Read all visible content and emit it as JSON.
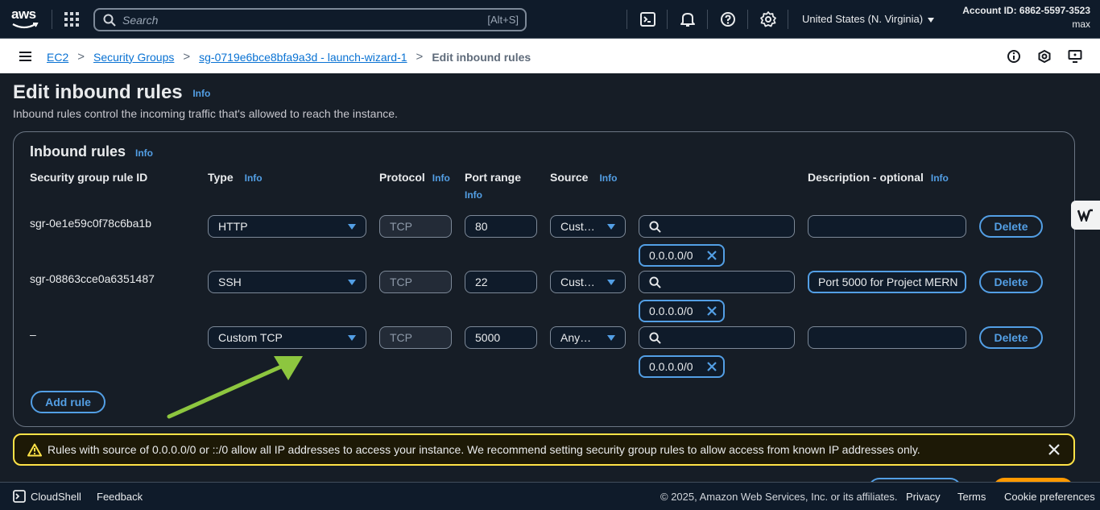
{
  "topnav": {
    "logo": "aws",
    "search_placeholder": "Search",
    "search_shortcut": "[Alt+S]",
    "region": "United States (N. Virginia)",
    "account_id": "Account ID: 6862-5597-3523",
    "user": "max",
    "icons": [
      "services-grid-icon",
      "cloudshell-icon",
      "bell-icon",
      "help-icon",
      "gear-icon"
    ]
  },
  "breadcrumb": {
    "items": [
      "EC2",
      "Security Groups",
      "sg-0719e6bce8bfa9a3d - launch-wizard-1"
    ],
    "current": "Edit inbound rules",
    "separator": ">"
  },
  "page": {
    "title": "Edit inbound rules",
    "info": "Info",
    "description": "Inbound rules control the incoming traffic that's allowed to reach the instance."
  },
  "container": {
    "title": "Inbound rules",
    "info": "Info",
    "columns": {
      "rule_id": "Security group rule ID",
      "type": "Type",
      "protocol": "Protocol",
      "port_range": "Port range",
      "source": "Source",
      "description": "Description - optional"
    },
    "rows": [
      {
        "rule_id": "sgr-0e1e59c0f78c6ba1b",
        "type": "HTTP",
        "protocol": "TCP",
        "port": "80",
        "source": "Cust…",
        "source_search": "",
        "cidr": "0.0.0.0/0",
        "description": "",
        "delete": "Delete"
      },
      {
        "rule_id": "sgr-08863cce0a6351487",
        "type": "SSH",
        "protocol": "TCP",
        "port": "22",
        "source": "Cust…",
        "source_search": "",
        "cidr": "0.0.0.0/0",
        "description": "Port 5000 for Project MERN",
        "delete": "Delete"
      },
      {
        "rule_id": "–",
        "type": "Custom TCP",
        "protocol": "TCP",
        "port": "5000",
        "source": "Any…",
        "source_search": "",
        "cidr": "0.0.0.0/0",
        "description": "",
        "delete": "Delete"
      }
    ],
    "add_rule": "Add rule"
  },
  "warning": {
    "text": "Rules with source of 0.0.0.0/0 or ::/0 allow all IP addresses to access your instance. We recommend setting security group rules to allow access from known IP addresses only."
  },
  "footer": {
    "cloudshell": "CloudShell",
    "feedback": "Feedback",
    "copyright": "© 2025, Amazon Web Services, Inc. or its affiliates.",
    "privacy": "Privacy",
    "terms": "Terms",
    "cookies": "Cookie preferences"
  },
  "colors": {
    "accent": "#539fe5",
    "warning_border": "#ffe347",
    "annotation_arrow": "#8dc63f"
  }
}
